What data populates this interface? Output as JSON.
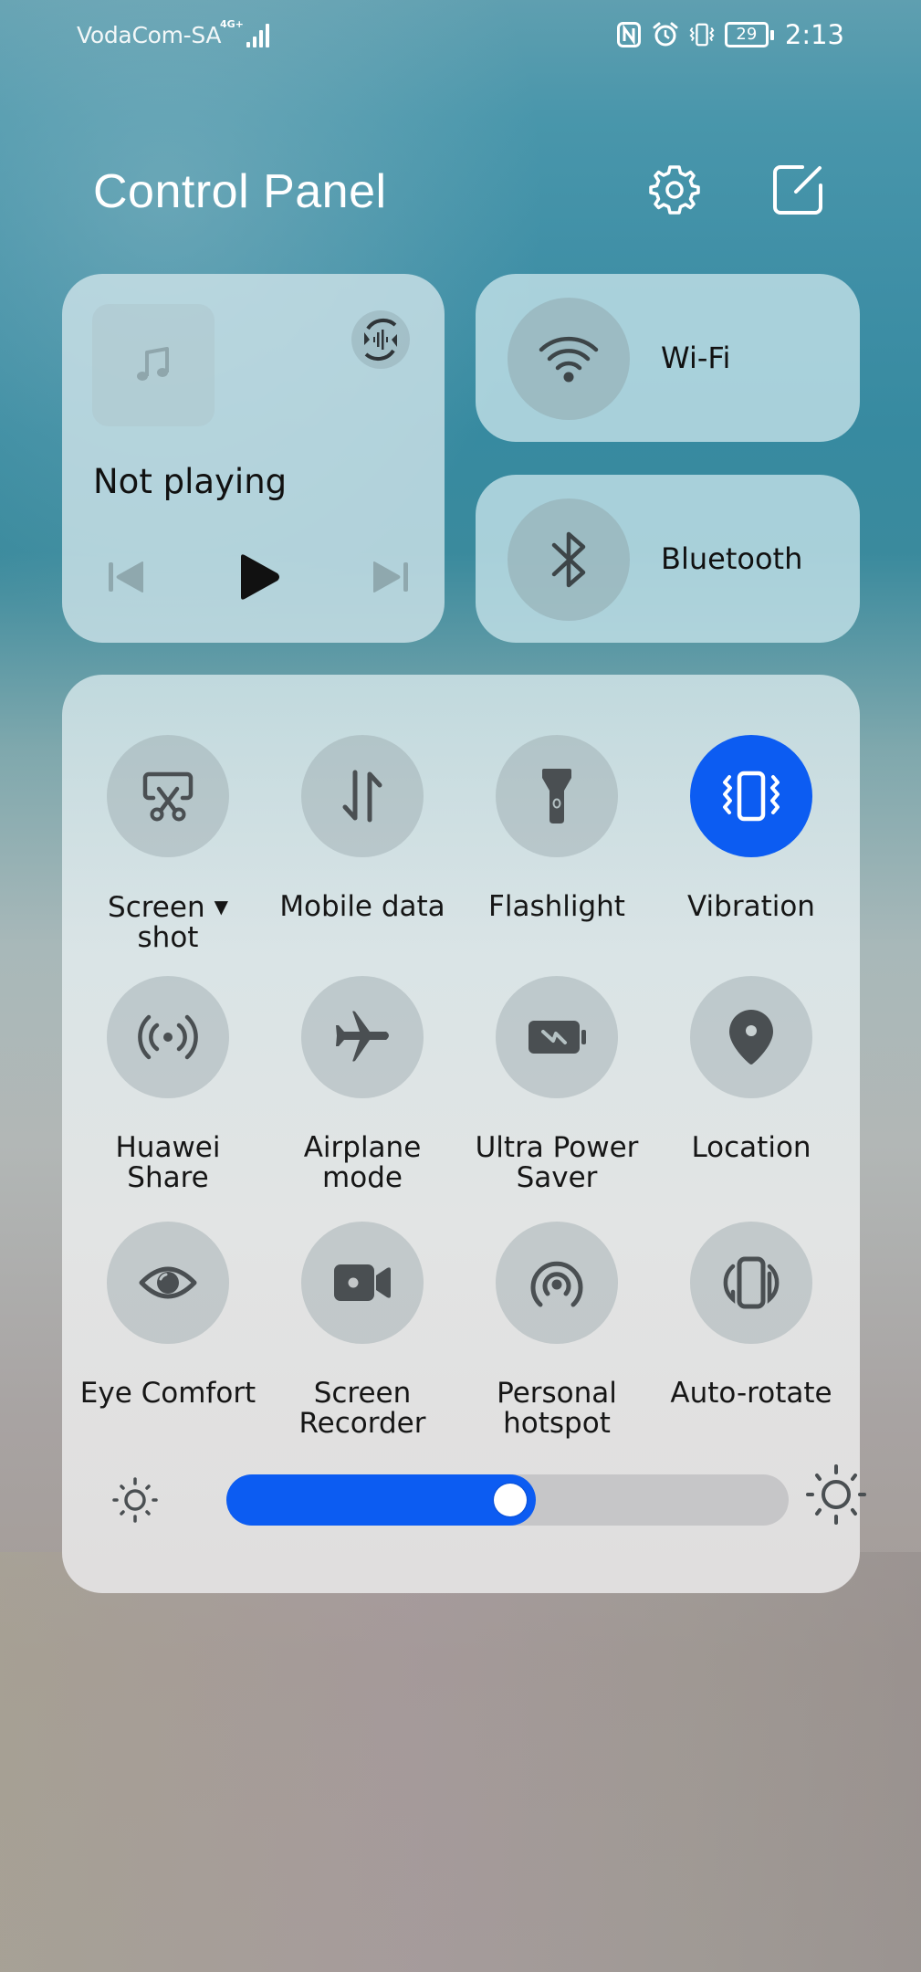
{
  "status_bar": {
    "carrier": "VodaCom-SA",
    "network_type": "4G+",
    "signal_bars": 4,
    "icons": [
      "nfc-icon",
      "alarm-icon",
      "vibrate-icon"
    ],
    "battery_level": "29",
    "time": "2:13"
  },
  "header": {
    "title": "Control Panel",
    "settings_icon": "gear-icon",
    "edit_icon": "edit-icon"
  },
  "media": {
    "title": "Not playing",
    "album_art_icon": "music-note-icon",
    "audio_output_icon": "audio-switch-icon",
    "controls": {
      "previous": "previous-icon",
      "play": "play-icon",
      "next": "next-icon"
    }
  },
  "connectivity": {
    "wifi": {
      "label": "Wi-Fi",
      "icon": "wifi-icon",
      "active": false
    },
    "bluetooth": {
      "label": "Bluetooth",
      "icon": "bluetooth-icon",
      "active": false
    }
  },
  "toggles": [
    {
      "label_line1": "Screen",
      "label_line2": "shot",
      "icon": "screenshot-icon",
      "active": false,
      "has_dropdown": true,
      "dropdown_glyph": "▼"
    },
    {
      "label_line1": "Mobile data",
      "label_line2": "",
      "icon": "mobile-data-icon",
      "active": false
    },
    {
      "label_line1": "Flashlight",
      "label_line2": "",
      "icon": "flashlight-icon",
      "active": false
    },
    {
      "label_line1": "Vibration",
      "label_line2": "",
      "icon": "vibration-icon",
      "active": true
    },
    {
      "label_line1": "Huawei",
      "label_line2": "Share",
      "icon": "huawei-share-icon",
      "active": false
    },
    {
      "label_line1": "Airplane",
      "label_line2": "mode",
      "icon": "airplane-icon",
      "active": false
    },
    {
      "label_line1": "Ultra Power",
      "label_line2": "Saver",
      "icon": "power-saver-icon",
      "active": false
    },
    {
      "label_line1": "Location",
      "label_line2": "",
      "icon": "location-icon",
      "active": false
    },
    {
      "label_line1": "Eye Comfort",
      "label_line2": "",
      "icon": "eye-icon",
      "active": false
    },
    {
      "label_line1": "Screen",
      "label_line2": "Recorder",
      "icon": "screen-recorder-icon",
      "active": false
    },
    {
      "label_line1": "Personal",
      "label_line2": "hotspot",
      "icon": "hotspot-icon",
      "active": false
    },
    {
      "label_line1": "Auto-rotate",
      "label_line2": "",
      "icon": "auto-rotate-icon",
      "active": false
    }
  ],
  "brightness": {
    "value_percent": 55,
    "min_icon": "brightness-low-icon",
    "max_icon": "brightness-high-icon"
  },
  "colors": {
    "accent": "#0c5cf2",
    "icon_dark": "#4a4f52",
    "text": "#161616"
  }
}
